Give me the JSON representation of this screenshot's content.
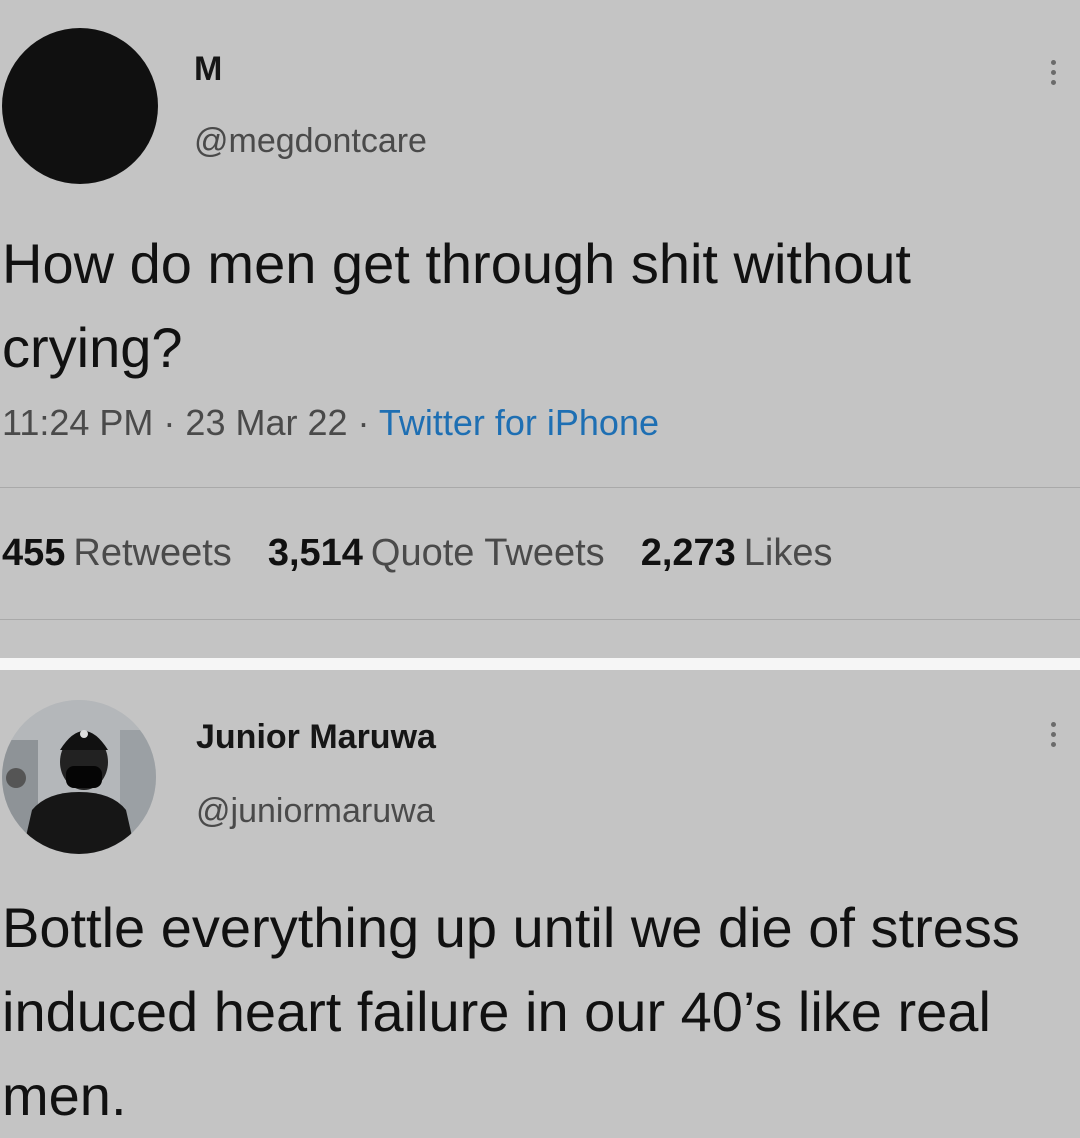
{
  "tweets": [
    {
      "display_name": "M",
      "handle": "@megdontcare",
      "text": "How do men get through shit without crying?",
      "time": "11:24 PM",
      "date": "23 Mar 22",
      "source": "Twitter for iPhone",
      "stats": {
        "retweets_count": "455",
        "retweets_label": "Retweets",
        "quote_count": "3,514",
        "quote_label": "Quote Tweets",
        "likes_count": "2,273",
        "likes_label": "Likes"
      }
    },
    {
      "display_name": "Junior Maruwa",
      "handle": "@juniormaruwa",
      "text": "Bottle everything up until we die of stress induced heart failure in our 40’s like real men."
    }
  ],
  "meta_separator": " · ",
  "icons": {
    "more": "more-vertical-icon"
  },
  "colors": {
    "background": "#c4c4c4",
    "link": "#1e6fb3",
    "separator": "#f6f6f6"
  }
}
